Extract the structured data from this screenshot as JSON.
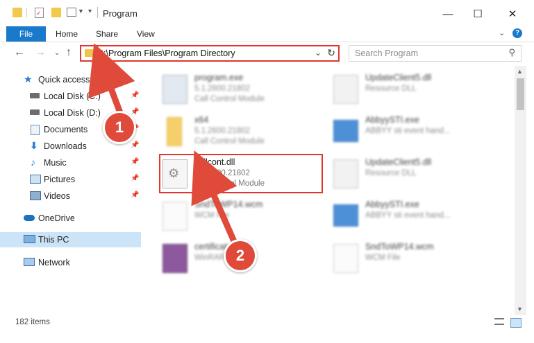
{
  "window": {
    "title": "Program",
    "minimize": "—",
    "maximize": "☐",
    "close": "✕"
  },
  "ribbon": {
    "tabs": [
      "File",
      "Home",
      "Share",
      "View"
    ]
  },
  "address": {
    "path": "C:\\Program Files\\Program Directory",
    "search_placeholder": "Search Program"
  },
  "nav": {
    "items": [
      {
        "label": "Quick access",
        "icon": "star-icon"
      },
      {
        "label": "Local Disk (C:)",
        "icon": "drive-icon",
        "pinned": true
      },
      {
        "label": "Local Disk (D:)",
        "icon": "drive-icon",
        "pinned": true
      },
      {
        "label": "Documents",
        "icon": "documents-icon",
        "pinned": true
      },
      {
        "label": "Downloads",
        "icon": "download-icon",
        "pinned": true
      },
      {
        "label": "Music",
        "icon": "music-icon",
        "pinned": true
      },
      {
        "label": "Pictures",
        "icon": "pictures-icon",
        "pinned": true
      },
      {
        "label": "Videos",
        "icon": "videos-icon",
        "pinned": true
      },
      {
        "label": "OneDrive",
        "icon": "cloud-icon"
      },
      {
        "label": "This PC",
        "icon": "computer-icon",
        "selected": true
      },
      {
        "label": "Network",
        "icon": "network-icon"
      }
    ]
  },
  "files": [
    {
      "name": "program.exe",
      "version": "5.1.2600.21802",
      "desc": "Call Control Module",
      "icon": "exe-icon"
    },
    {
      "name": "UpdateClient5.dll",
      "version": "Resource DLL",
      "desc": "",
      "icon": "dll-icon"
    },
    {
      "name": "x64",
      "version": "5.1.2600.21802",
      "desc": "Call Control Module",
      "icon": "folder-icon"
    },
    {
      "name": "AbbyySTI.exe",
      "version": "ABBYY sti event hand...",
      "desc": "",
      "icon": "exe-window-icon"
    },
    {
      "name": "callcont.dll",
      "version": "5.1.2600.21802",
      "desc": "Call Control Module",
      "icon": "gear-file-icon",
      "highlighted": true
    },
    {
      "name": "UpdateClient5.dll",
      "version": "Resource DLL",
      "desc": "",
      "icon": "dll-icon"
    },
    {
      "name": "SndToWP14.wcm",
      "version": "WCM File",
      "desc": "",
      "icon": "blank-file-icon"
    },
    {
      "name": "AbbyySTI.exe",
      "version": "ABBYY sti event hand...",
      "desc": "",
      "icon": "exe-window-icon"
    },
    {
      "name": "certificate.cab",
      "version": "WinRAR archive",
      "desc": "",
      "icon": "archive-icon"
    },
    {
      "name": "SndToWP14.wcm",
      "version": "WCM File",
      "desc": "",
      "icon": "blank-file-icon"
    }
  ],
  "status": {
    "count": "182 items"
  },
  "callouts": {
    "one": "1",
    "two": "2"
  },
  "colors": {
    "accent": "#1979ca",
    "highlight": "#e0362b",
    "selected": "#cce4f7"
  }
}
